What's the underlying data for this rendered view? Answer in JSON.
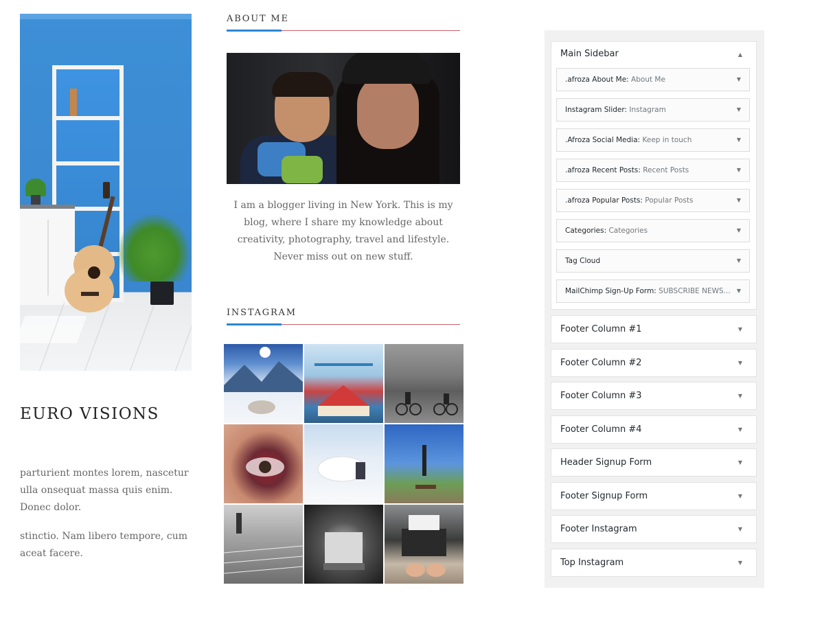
{
  "post": {
    "title": "EURO VISIONS",
    "paragraph_1": "parturient montes lorem, nascetur ulla onsequat massa quis enim. Donec dolor.",
    "paragraph_2": "stinctio. Nam libero tempore, cum aceat facere."
  },
  "about": {
    "heading": "ABOUT ME",
    "text": "I am a blogger living in New York. This is my blog, where I share my knowledge about creativity, photography, travel and lifestyle. Never miss out on new stuff."
  },
  "instagram": {
    "heading": "INSTAGRAM"
  },
  "admin": {
    "main_sidebar": {
      "title": "Main Sidebar",
      "widgets": [
        {
          "name": ".afroza About Me:",
          "title": " About Me"
        },
        {
          "name": "Instagram Slider:",
          "title": " Instagram"
        },
        {
          "name": ".Afroza Social Media:",
          "title": " Keep in touch"
        },
        {
          "name": ".afroza Recent Posts:",
          "title": " Recent Posts"
        },
        {
          "name": ".afroza Popular Posts:",
          "title": " Popular Posts"
        },
        {
          "name": "Categories:",
          "title": " Categories"
        },
        {
          "name": "Tag Cloud",
          "title": ""
        },
        {
          "name": "MailChimp Sign-Up Form:",
          "title": " SUBSCRIBE NEWS..."
        }
      ]
    },
    "areas": [
      {
        "title": "Footer Column #1"
      },
      {
        "title": "Footer Column #2"
      },
      {
        "title": "Footer Column #3"
      },
      {
        "title": "Footer Column #4"
      },
      {
        "title": "Header Signup Form"
      },
      {
        "title": "Footer Signup Form"
      },
      {
        "title": "Footer Instagram"
      },
      {
        "title": "Top Instagram"
      }
    ],
    "arrow_down": "▼",
    "arrow_up": "▲"
  },
  "colors": {
    "accent_blue": "#2c86d6",
    "rule_red": "#c9636b",
    "admin_bg": "#f1f1f1"
  }
}
